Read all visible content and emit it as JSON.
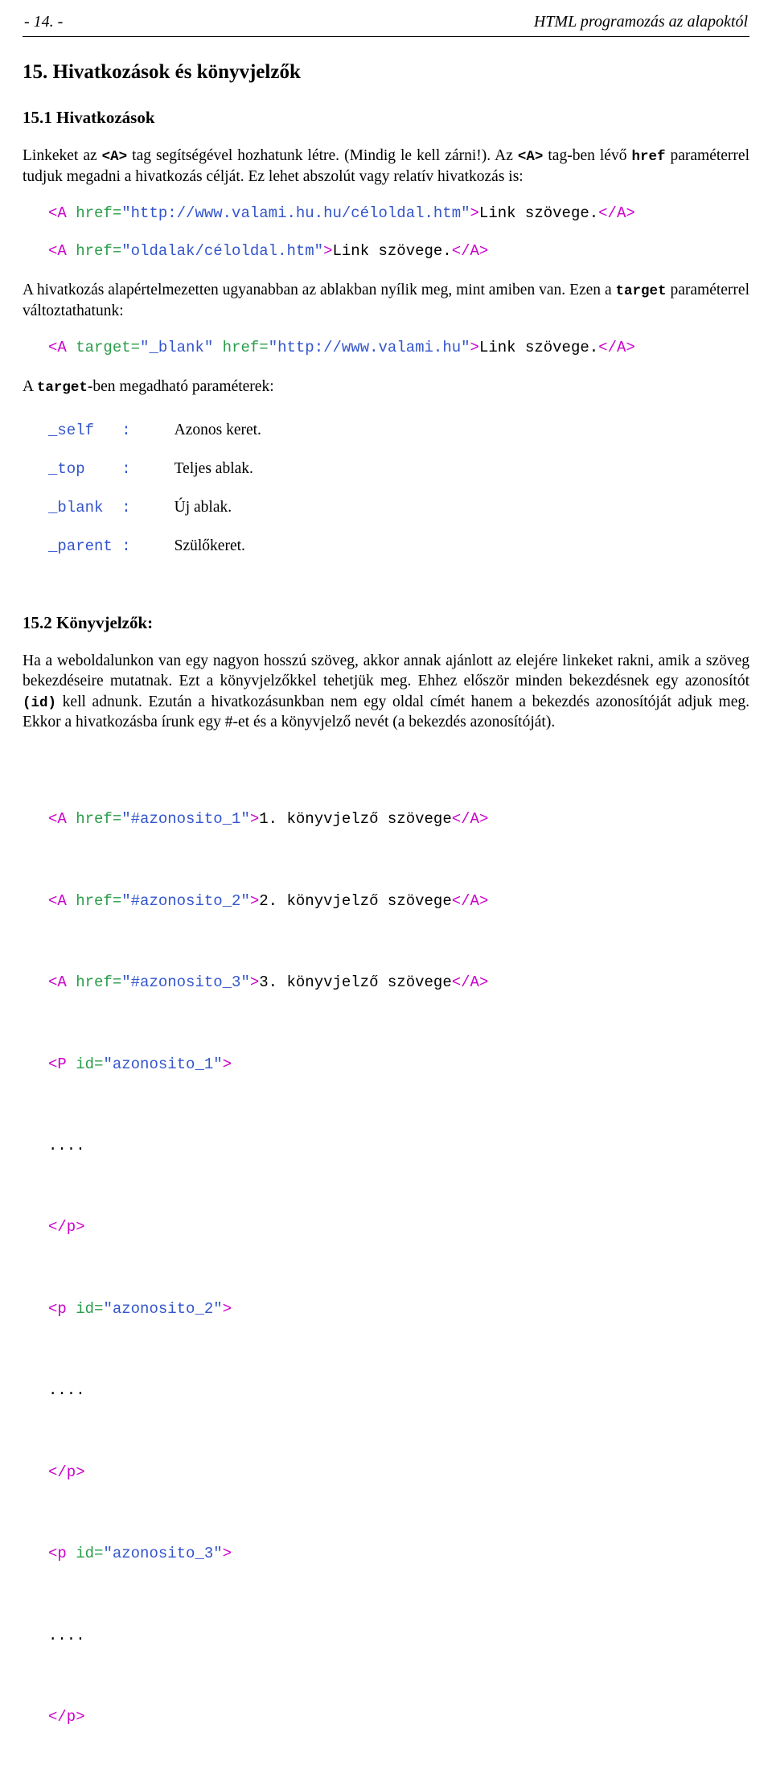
{
  "header": {
    "page_marker": "- 14. -",
    "book_title": "HTML programozás az alapoktól"
  },
  "chapter": {
    "title": "15. Hivatkozások és könyvjelzők",
    "section1_title": "15.1  Hivatkozások",
    "section2_title": "15.2  Könyvjelzők:"
  },
  "paragraphs": {
    "intro_1": "Linkeket az ",
    "intro_1_code1": "<A>",
    "intro_1_b": " tag segítségével hozhatunk létre. (Mindig le kell zárni!)",
    "intro_1_c": ". Az ",
    "intro_1_code2": "<A>",
    "intro_1_d": " tag-ben lévő ",
    "intro_1_code3": "href",
    "intro_1_e": " paraméterrel tudjuk megadni a hivatkozás célját. Ez lehet abszolút vagy relatív hivatkozás is:",
    "target_1a": "A hivatkozás alapértelmezetten ugyanabban az ablakban nyílik meg, mint amiben van. Ezen a ",
    "target_1_code": "target",
    "target_1b": " paraméterrel változtathatunk:",
    "target_2a": "A ",
    "target_2_code": "target",
    "target_2b": "-ben megadható paraméterek:",
    "bookmarks_1": "Ha a weboldalunkon van egy nagyon hosszú szöveg, akkor annak ajánlott az elejére linkeket rakni, amik a szöveg bekezdéseire mutatnak. Ezt a könyvjelzőkkel tehetjük meg. Ehhez először minden bekezdésnek egy azonosítót ",
    "bookmarks_1_code": "(id)",
    "bookmarks_1b": " kell adnunk. Ezután a hivatkozásunkban nem egy oldal címét hanem a bekezdés azonosítóját adjuk meg. Ekkor a hivatkozásba írunk egy #-et és a könyvjelző nevét (a bekezdés azonosítóját)."
  },
  "code_blocks": {
    "abs_link": {
      "tag_open": "<A ",
      "attr": "href=",
      "value": "\"http://www.valami.hu.hu/céloldal.htm\"",
      "gt": ">",
      "text": "Link szövege.",
      "tag_close": "</A>"
    },
    "rel_link": {
      "tag_open": "<A ",
      "attr": "href=",
      "value": "\"oldalak/céloldal.htm\"",
      "gt": ">",
      "text": "Link szövege.",
      "tag_close": "</A>"
    },
    "target_link": {
      "tag_open": "<A ",
      "attr1": "target=",
      "value1": "\"_blank\" ",
      "attr2": "href=",
      "value2": "\"http://www.valami.hu\"",
      "gt": ">",
      "text": "Link szövege.",
      "tag_close": "</A>"
    }
  },
  "target_params": [
    {
      "key": "_self   :",
      "value": "Azonos keret."
    },
    {
      "key": "_top    :",
      "value": "Teljes ablak."
    },
    {
      "key": "_blank  :",
      "value": "Új ablak."
    },
    {
      "key": "_parent :",
      "value": "Szülőkeret."
    }
  ],
  "bookmark_listing": [
    {
      "tag": "<A ",
      "attr": "href=",
      "value": "\"#azonosito_1\"",
      "gt": ">",
      "text": "1. könyvjelző szövege",
      "close": "</A>"
    },
    {
      "tag": "<A ",
      "attr": "href=",
      "value": "\"#azonosito_2\"",
      "gt": ">",
      "text": "2. könyvjelző szövege",
      "close": "</A>"
    },
    {
      "tag": "<A ",
      "attr": "href=",
      "value": "\"#azonosito_3\"",
      "gt": ">",
      "text": "3. könyvjelző szövege",
      "close": "</A>"
    },
    {
      "tag": "<P ",
      "attr": "id=",
      "value": "\"azonosito_1\"",
      "gt": ">",
      "text": "",
      "close": ""
    },
    {
      "plain": "...."
    },
    {
      "tag": "</p>"
    },
    {
      "tag": "<p ",
      "attr": "id=",
      "value": "\"azonosito_2\"",
      "gt": ">",
      "text": "",
      "close": ""
    },
    {
      "plain": "...."
    },
    {
      "tag": "</p>"
    },
    {
      "tag": "<p ",
      "attr": "id=",
      "value": "\"azonosito_3\"",
      "gt": ">",
      "text": "",
      "close": ""
    },
    {
      "plain": "...."
    },
    {
      "tag": "</p>"
    }
  ],
  "colors": {
    "tag": "#cc00cc",
    "attr": "#2a9d4a",
    "string": "#3355cc",
    "text": "#000000"
  }
}
